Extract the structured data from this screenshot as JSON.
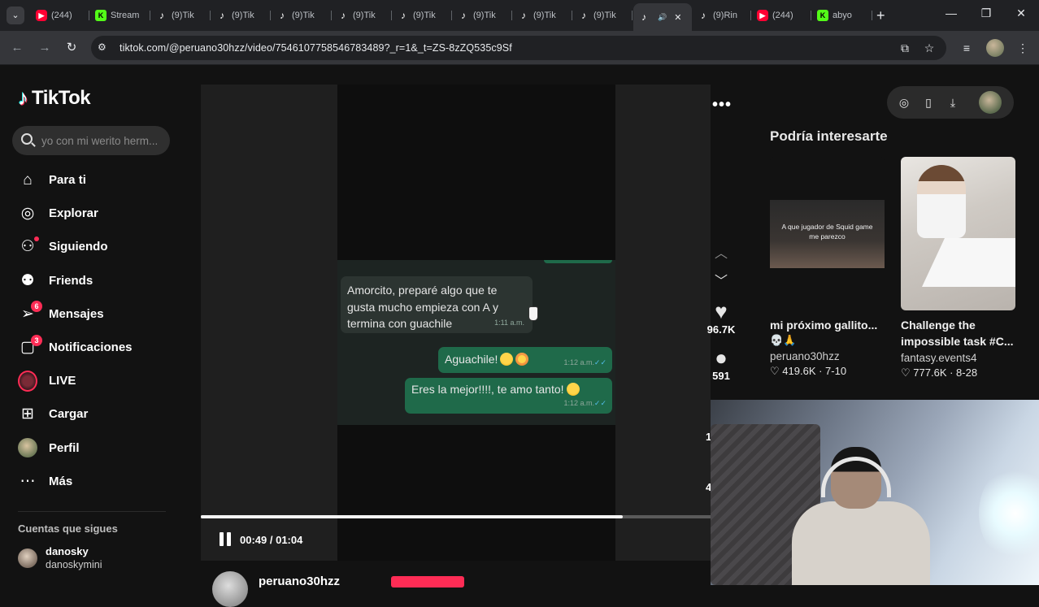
{
  "browser": {
    "tabs": [
      {
        "icon": "youtube-icon",
        "label": "(244)"
      },
      {
        "icon": "kick-icon",
        "label": "Stream"
      },
      {
        "icon": "tiktok-icon",
        "label": "(9)Tik"
      },
      {
        "icon": "tiktok-icon",
        "label": "(9)Tik"
      },
      {
        "icon": "tiktok-icon",
        "label": "(9)Tik"
      },
      {
        "icon": "tiktok-icon",
        "label": "(9)Tik"
      },
      {
        "icon": "tiktok-icon",
        "label": "(9)Tik"
      },
      {
        "icon": "tiktok-icon",
        "label": "(9)Tik"
      },
      {
        "icon": "tiktok-icon",
        "label": "(9)Tik"
      },
      {
        "icon": "tiktok-icon",
        "label": "(9)Tik"
      },
      {
        "icon": "tiktok-icon",
        "label": "",
        "active": true
      },
      {
        "icon": "tiktok-icon",
        "label": "(9)Rin"
      },
      {
        "icon": "youtube-icon",
        "label": "(244)"
      },
      {
        "icon": "kick-icon",
        "label": "abyo"
      }
    ],
    "url": "tiktok.com/@peruano30hzz/video/7546107758546783489?_r=1&_t=ZS-8zZQ535c9Sf"
  },
  "sidebar": {
    "logo": "TikTok",
    "search_placeholder": "yo con mi werito herm...",
    "items": [
      {
        "label": "Para ti",
        "icon": "home-icon"
      },
      {
        "label": "Explorar",
        "icon": "compass-icon"
      },
      {
        "label": "Siguiendo",
        "icon": "following-icon"
      },
      {
        "label": "Friends",
        "icon": "friends-icon"
      },
      {
        "label": "Mensajes",
        "icon": "messages-icon",
        "badge": "6"
      },
      {
        "label": "Notificaciones",
        "icon": "notifications-icon",
        "badge": "3"
      },
      {
        "label": "LIVE",
        "icon": "live-icon"
      },
      {
        "label": "Cargar",
        "icon": "upload-icon"
      },
      {
        "label": "Perfil",
        "icon": "profile-icon"
      },
      {
        "label": "Más",
        "icon": "more-icon"
      }
    ],
    "following_title": "Cuentas que sigues",
    "following": [
      {
        "name": "danosky",
        "handle": "danoskymini"
      }
    ]
  },
  "video": {
    "messages": [
      {
        "text": "Amorcito, preparé algo que te gusta mucho empieza con A y termina con guachile",
        "time": "1:11 a.m."
      },
      {
        "text": "Aguachile!",
        "time": "1:12 a.m."
      },
      {
        "text": "Eres la mejor!!!!, te amo tanto!",
        "time": "1:12 a.m."
      }
    ],
    "time_current": "00:49",
    "time_total": "01:04",
    "time_display": "00:49 / 01:04",
    "progress": 0.828,
    "likes": "96.7K",
    "comments": "591",
    "author": "peruano30hzz",
    "partial_counts": [
      "1",
      "4"
    ]
  },
  "recommendations": {
    "title": "Podría interesarte",
    "cards": [
      {
        "thumb_caption": "A que jugador de Squid game me parezco",
        "title": "mi próximo gallito...",
        "title2": "💀🙏",
        "author": "peruano30hzz",
        "likes": "419.6K",
        "date": "7-10"
      },
      {
        "thumb_caption": "",
        "title": "Challenge the impossible task #C...",
        "title2": "",
        "author": "fantasy.events4",
        "likes": "777.6K",
        "date": "8-28"
      }
    ]
  },
  "colors": {
    "accent": "#fe2c55",
    "whatsapp_out": "#1f6a4a",
    "background": "#121212"
  }
}
